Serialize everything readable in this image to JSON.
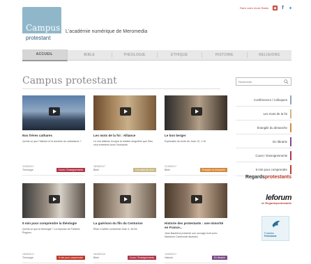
{
  "header": {
    "top_link": "Faire votre choix Radio",
    "logo_line1": "Campus",
    "logo_line2": "protestant",
    "tagline": "L'académie numérique de Meromedia"
  },
  "nav": {
    "items": [
      {
        "label": "ACCUEIL",
        "active": true
      },
      {
        "label": "BIBLE",
        "active": false
      },
      {
        "label": "THÉOLOGIE",
        "active": false
      },
      {
        "label": "ÉTHIQUE",
        "active": false
      },
      {
        "label": "HISTOIRE",
        "active": false
      },
      {
        "label": "RELIGIONS",
        "active": false
      }
    ]
  },
  "page": {
    "title": "Campus protestant"
  },
  "search": {
    "placeholder": "Recherche"
  },
  "cards": [
    {
      "title": "Nos frères cathares",
      "text": "Qu'est-ce que l'histoire et la doctrine du catharisme ?",
      "date": "11/05/2017",
      "category": "Théologie",
      "badge": "Cours / Enseignements",
      "badge_color": "#b0374b"
    },
    {
      "title": "Les mots de la foi : Alliance",
      "text": "Le mot alliance évoque la relation singulière que Dieu veut entretenir avec l'humanité.",
      "date": "28/05/2017",
      "category": "Bible",
      "badge": "Les mots de la foi",
      "badge_color": "#c9b98a"
    },
    {
      "title": "Le bon berger",
      "text": "Explication du texte de Jean 10, 1-10.",
      "date": "21/05/2017",
      "category": "Bible",
      "badge": "Évangile du dimanche",
      "badge_color": "#d28a3a"
    },
    {
      "title": "5 min pour comprendre la théologie",
      "text": "Qu'est-ce que la théologie ? La réponse de Frédéric Rognon.",
      "date": "18/05/2017",
      "category": "Théologie",
      "badge": "5 min pour comprendre",
      "badge_color": "#c0392b"
    },
    {
      "title": "La guérison du fils du Centurion",
      "text": "Élian Cuvillier commente Jean 4, 46-54.",
      "date": "06/09/2016",
      "category": "Bible",
      "badge": "Cours / Enseignements",
      "badge_color": "#b0374b"
    },
    {
      "title": "Histoire des protestants : une minorité en France...",
      "text": "Jean Baubérot présente son ouvrage écrit avec Marianne Carbonnier-Burkard.",
      "date": "10/05/2017",
      "category": "Histoire",
      "badge": "En librairie",
      "badge_color": "#7e4b8b"
    }
  ],
  "sidebar": {
    "items": [
      {
        "label": "Conférences / Colloques",
        "color": "#8aa7bd"
      },
      {
        "label": "Les mots de la foi",
        "color": "#c9b98a"
      },
      {
        "label": "Évangile du dimanche",
        "color": "#d28a3a"
      },
      {
        "label": "En librairie",
        "color": "#7e4b8b"
      },
      {
        "label": "Cours / Enseignements",
        "color": "#b0374b"
      },
      {
        "label": "5 min pour comprendre",
        "color": "#c0392b"
      }
    ],
    "partner_regards_1": "Regards",
    "partner_regards_2": "protestants",
    "partner_forum_big": "leforum",
    "partner_forum_small_1": "de ",
    "partner_forum_small_2": "Regardsprotestants",
    "partner_fp_1": "Fondation",
    "partner_fp_2": "Protestante"
  },
  "colors": {
    "accent": "#c0392b",
    "logo_bg": "#8fb7c9",
    "nav_bg": "#e8e8e8"
  }
}
